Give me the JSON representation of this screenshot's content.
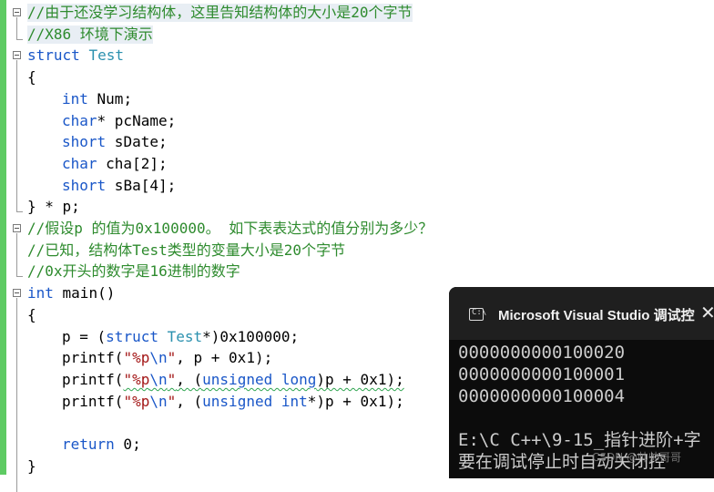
{
  "editor": {
    "lines": [
      {
        "segments": [
          {
            "t": "//由于还没学习结构体，这里告知结构体的大小是20个字节",
            "c": "cmt"
          }
        ]
      },
      {
        "segments": [
          {
            "t": "//X86 环境下演示",
            "c": "cmt"
          }
        ]
      },
      {
        "segments": [
          {
            "t": "struct ",
            "c": "kw"
          },
          {
            "t": "Test",
            "c": "type"
          }
        ]
      },
      {
        "segments": [
          {
            "t": "{",
            "c": ""
          }
        ]
      },
      {
        "segments": [
          {
            "t": "int",
            "c": "kw"
          },
          {
            "t": " Num;",
            "c": ""
          }
        ]
      },
      {
        "segments": [
          {
            "t": "char",
            "c": "kw"
          },
          {
            "t": "* pcName;",
            "c": ""
          }
        ]
      },
      {
        "segments": [
          {
            "t": "short",
            "c": "kw"
          },
          {
            "t": " sDate;",
            "c": ""
          }
        ]
      },
      {
        "segments": [
          {
            "t": "char",
            "c": "kw"
          },
          {
            "t": " cha[2];",
            "c": ""
          }
        ]
      },
      {
        "segments": [
          {
            "t": "short",
            "c": "kw"
          },
          {
            "t": " sBa[4];",
            "c": ""
          }
        ]
      },
      {
        "segments": [
          {
            "t": "} * p;",
            "c": ""
          }
        ]
      },
      {
        "segments": [
          {
            "t": "//假设p 的值为0x100000。 如下表表达式的值分别为多少？",
            "c": "cmt"
          }
        ]
      },
      {
        "segments": [
          {
            "t": "//已知，结构体Test类型的变量大小是20个字节",
            "c": "cmt"
          }
        ]
      },
      {
        "segments": [
          {
            "t": "//0x开头的数字是16进制的数字",
            "c": "cmt"
          }
        ]
      },
      {
        "segments": [
          {
            "t": "int",
            "c": "kw"
          },
          {
            "t": " main()",
            "c": ""
          }
        ]
      },
      {
        "segments": [
          {
            "t": "{",
            "c": ""
          }
        ]
      },
      {
        "segments": [
          {
            "t": "p = (",
            "c": ""
          },
          {
            "t": "struct ",
            "c": "kw"
          },
          {
            "t": "Test",
            "c": "type"
          },
          {
            "t": "*)0x100000;",
            "c": ""
          }
        ]
      },
      {
        "segments": [
          {
            "t": "printf(",
            "c": ""
          },
          {
            "t": "\"%p",
            "c": "str"
          },
          {
            "t": "\\n",
            "c": "kw"
          },
          {
            "t": "\"",
            "c": "str"
          },
          {
            "t": ", p + 0x1);",
            "c": ""
          }
        ]
      },
      {
        "segments": [
          {
            "t": "printf(",
            "c": ""
          },
          {
            "t": "\"%p",
            "c": "str"
          },
          {
            "t": "\\n",
            "c": "kw"
          },
          {
            "t": "\"",
            "c": "str"
          },
          {
            "t": ", (",
            "c": ""
          },
          {
            "t": "unsigned long",
            "c": "kw"
          },
          {
            "t": ")p + 0x1);",
            "c": ""
          }
        ]
      },
      {
        "segments": [
          {
            "t": "printf(",
            "c": ""
          },
          {
            "t": "\"%p",
            "c": "str"
          },
          {
            "t": "\\n",
            "c": "kw"
          },
          {
            "t": "\"",
            "c": "str"
          },
          {
            "t": ", (",
            "c": ""
          },
          {
            "t": "unsigned int",
            "c": "kw"
          },
          {
            "t": "*)p + 0x1);",
            "c": ""
          }
        ]
      },
      {
        "segments": []
      },
      {
        "segments": [
          {
            "t": "return",
            "c": "kw"
          },
          {
            "t": " 0;",
            "c": ""
          }
        ]
      },
      {
        "segments": [
          {
            "t": "}",
            "c": ""
          }
        ]
      }
    ]
  },
  "console": {
    "icon_label": "C:\\",
    "title": "Microsoft Visual Studio 调试控",
    "close": "✕",
    "output": [
      "0000000000100020",
      "0000000000100001",
      "0000000000100004",
      "",
      "E:\\C C++\\9-15_指针进阶+字",
      "要在调试停止时自动关闭控"
    ]
  },
  "watermark": "CSDN @帅帅哥哥"
}
